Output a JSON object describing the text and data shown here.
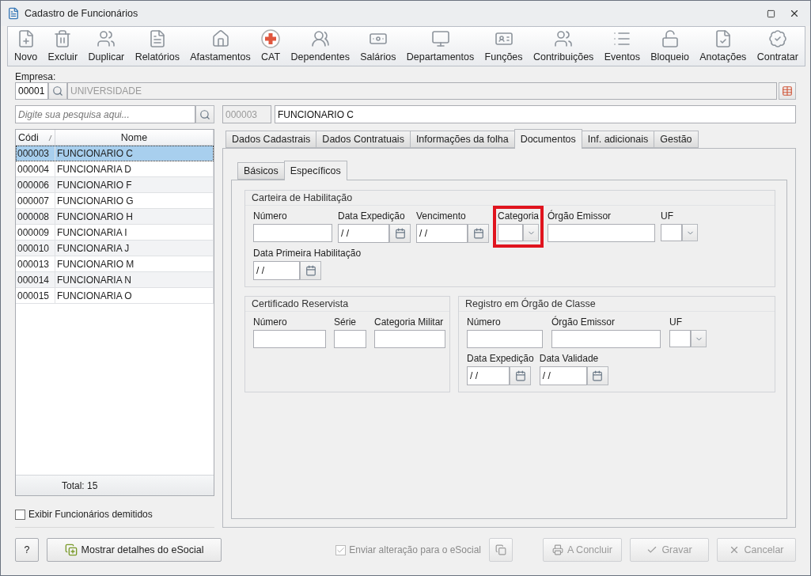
{
  "window": {
    "title": "Cadastro de Funcionários"
  },
  "toolbar": [
    {
      "label": "Novo"
    },
    {
      "label": "Excluir"
    },
    {
      "label": "Duplicar"
    },
    {
      "label": "Relatórios"
    },
    {
      "label": "Afastamentos"
    },
    {
      "label": "CAT"
    },
    {
      "label": "Dependentes"
    },
    {
      "label": "Salários"
    },
    {
      "label": "Departamentos"
    },
    {
      "label": "Funções"
    },
    {
      "label": "Contribuições"
    },
    {
      "label": "Eventos"
    },
    {
      "label": "Bloqueio"
    },
    {
      "label": "Anotações"
    },
    {
      "label": "Contratar"
    }
  ],
  "empresa": {
    "label": "Empresa:",
    "code": "00001",
    "name": "UNIVERSIDADE"
  },
  "search": {
    "placeholder": "Digite sua pesquisa aqui..."
  },
  "employee": {
    "code": "000003",
    "name": "FUNCIONARIO C"
  },
  "table": {
    "columns": [
      "Códi",
      "Nome"
    ],
    "rows": [
      {
        "code": "000003",
        "name": "FUNCIONARIO C",
        "selected": true
      },
      {
        "code": "000004",
        "name": "FUNCIONARIA D",
        "selected": false
      },
      {
        "code": "000006",
        "name": "FUNCIONARIO F",
        "selected": false
      },
      {
        "code": "000007",
        "name": "FUNCIONARIO G",
        "selected": false
      },
      {
        "code": "000008",
        "name": "FUNCIONARIO H",
        "selected": false
      },
      {
        "code": "000009",
        "name": "FUNCIONARIA I",
        "selected": false
      },
      {
        "code": "000010",
        "name": "FUNCIONARIA J",
        "selected": false
      },
      {
        "code": "000013",
        "name": "FUNCIONARIO M",
        "selected": false
      },
      {
        "code": "000014",
        "name": "FUNCIONARIA N",
        "selected": false
      },
      {
        "code": "000015",
        "name": "FUNCIONARIA O",
        "selected": false
      }
    ],
    "footer": "Total: 15"
  },
  "show_dismissed": {
    "label": "Exibir Funcionários demitidos",
    "checked": false
  },
  "tabs": [
    {
      "label": "Dados Cadastrais",
      "selected": false
    },
    {
      "label": "Dados Contratuais",
      "selected": false
    },
    {
      "label": "Informações da folha",
      "selected": false
    },
    {
      "label": "Documentos",
      "selected": true
    },
    {
      "label": "Inf. adicionais",
      "selected": false
    },
    {
      "label": "Gestão",
      "selected": false
    }
  ],
  "subtabs": [
    {
      "label": "Básicos",
      "selected": false
    },
    {
      "label": "Específicos",
      "selected": true
    }
  ],
  "groups": [
    {
      "title": "Carteira de Habilitação",
      "rows": [
        [
          {
            "label": "Número",
            "kind": "text"
          },
          {
            "label": "Data Expedição",
            "kind": "date",
            "value": "/ /"
          },
          {
            "label": "Vencimento",
            "kind": "date",
            "value": "/ /"
          },
          {
            "label": "Categoria",
            "kind": "select",
            "highlighted": true
          },
          {
            "label": "Órgão Emissor",
            "kind": "text"
          },
          {
            "label": "UF",
            "kind": "select"
          }
        ],
        [
          {
            "label": "Data Primeira Habilitação",
            "kind": "date",
            "value": "/ /"
          }
        ]
      ]
    },
    {
      "title": "Certificado Reservista",
      "rows": [
        [
          {
            "label": "Número",
            "kind": "text"
          },
          {
            "label": "Série",
            "kind": "text"
          },
          {
            "label": "Categoria Militar",
            "kind": "text"
          }
        ]
      ]
    },
    {
      "title": "Registro em Órgão de Classe",
      "rows": [
        [
          {
            "label": "Número",
            "kind": "text"
          },
          {
            "label": "Órgão Emissor",
            "kind": "text"
          },
          {
            "label": "UF",
            "kind": "select"
          }
        ],
        [
          {
            "label": "Data Expedição",
            "kind": "date",
            "value": "/ /"
          },
          {
            "label": "Data Validade",
            "kind": "date",
            "value": "/ /"
          }
        ]
      ]
    }
  ],
  "footer": {
    "help": "?",
    "esocial_button": "Mostrar detalhes do eSocial",
    "send_esocial": {
      "label": "Enviar alteração para o eSocial",
      "checked": true,
      "disabled": true
    },
    "actions": [
      {
        "label": "A Concluir",
        "disabled": true
      },
      {
        "label": "Gravar",
        "disabled": true
      },
      {
        "label": "Cancelar",
        "disabled": true
      }
    ]
  }
}
